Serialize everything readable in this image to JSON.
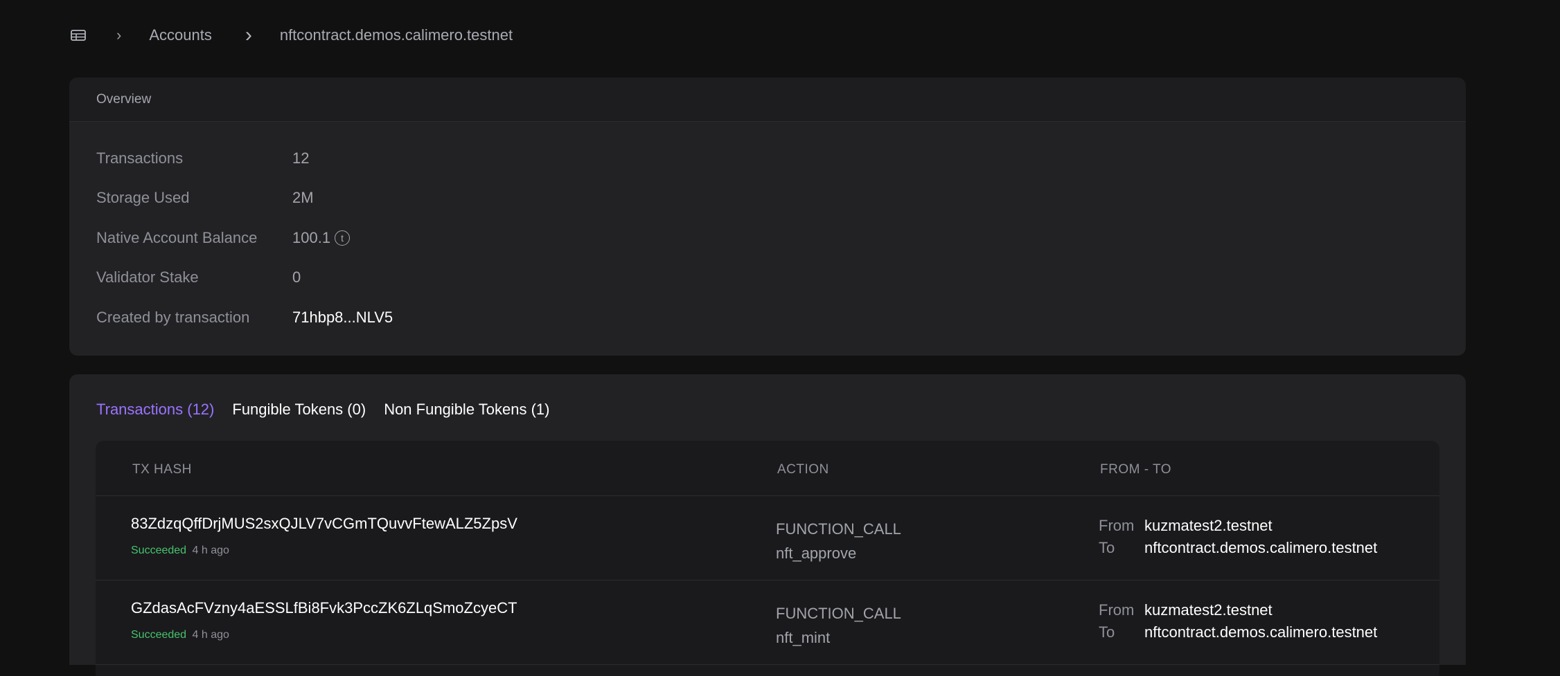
{
  "breadcrumb": {
    "home_icon": "table-icon",
    "sep_small": "›",
    "accounts": "Accounts",
    "sep_large": "›",
    "current": "nftcontract.demos.calimero.testnet"
  },
  "overview": {
    "title": "Overview",
    "rows": [
      {
        "label": "Transactions",
        "value": "12"
      },
      {
        "label": "Storage Used",
        "value": "2M"
      },
      {
        "label": "Native Account Balance",
        "value": "100.1",
        "icon_glyph": "ⓣ"
      },
      {
        "label": "Validator Stake",
        "value": "0"
      },
      {
        "label": "Created by transaction",
        "value": "71hbp8...NLV5"
      }
    ]
  },
  "tabs": [
    {
      "label": "Transactions (12)"
    },
    {
      "label": "Fungible Tokens (0)"
    },
    {
      "label": "Non Fungible Tokens (1)"
    }
  ],
  "table": {
    "headers": {
      "hash": "TX HASH",
      "action": "ACTION",
      "fromto": "FROM - TO"
    },
    "rows": [
      {
        "hash": "83ZdzqQffDrjMUS2sxQJLV7vCGmTQuvvFtewALZ5ZpsV",
        "status": "Succeeded",
        "time": "4 h ago",
        "action_type": "FUNCTION_CALL",
        "method": "nft_approve",
        "from_label": "From",
        "from": "kuzmatest2.testnet",
        "to_label": "To",
        "to": "nftcontract.demos.calimero.testnet"
      },
      {
        "hash": "GZdasAcFVzny4aESSLfBi8Fvk3PccZK6ZLqSmoZcyeCT",
        "status": "Succeeded",
        "time": "4 h ago",
        "action_type": "FUNCTION_CALL",
        "method": "nft_mint",
        "from_label": "From",
        "from": "kuzmatest2.testnet",
        "to_label": "To",
        "to": "nftcontract.demos.calimero.testnet"
      }
    ]
  },
  "colors": {
    "accent": "#9b73ff",
    "success": "#45c46b",
    "background": "#111112",
    "panel": "#222225"
  }
}
